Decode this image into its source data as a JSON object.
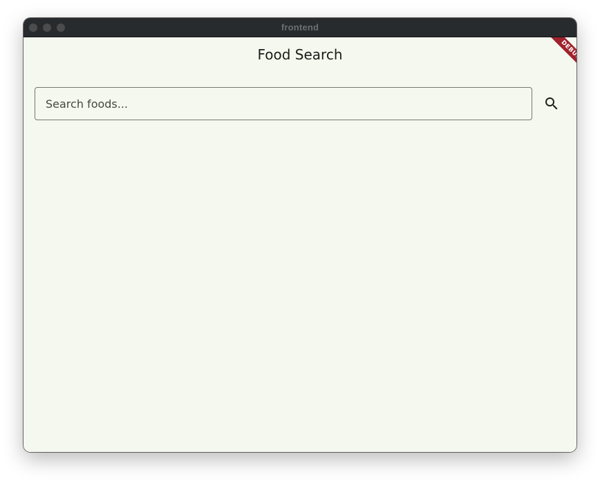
{
  "window": {
    "title": "frontend"
  },
  "app": {
    "title": "Food Search",
    "debug_banner": "DEBUG"
  },
  "search": {
    "placeholder": "Search foods...",
    "value": "",
    "button_icon": "search-icon"
  },
  "colors": {
    "background": "#f5f8ef",
    "titlebar": "#282b2d",
    "debug_banner": "#a0222d",
    "field_border": "#74776d"
  }
}
